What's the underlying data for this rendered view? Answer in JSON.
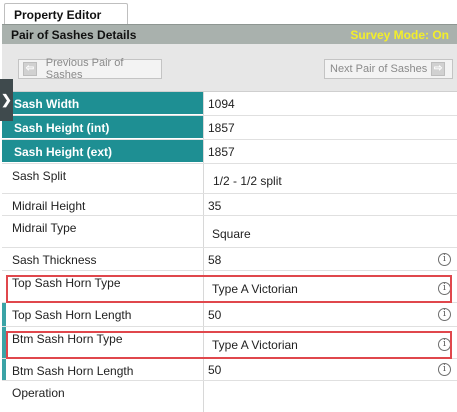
{
  "tab": {
    "label": "Property Editor"
  },
  "header": {
    "title": "Pair of Sashes Details",
    "status": "Survey Mode: On"
  },
  "nav": {
    "prev_label": "Previous Pair of Sashes",
    "next_label": "Next Pair of Sashes"
  },
  "colors": {
    "key_label_bg": "#1e8f93",
    "header_bg": "#a9b1ad",
    "status_text": "#f3ee2a",
    "highlight": "#e0474c"
  },
  "rows": [
    {
      "label": "Sash Width",
      "value": "1094"
    },
    {
      "label": "Sash Height (int)",
      "value": "1857"
    },
    {
      "label": "Sash Height (ext)",
      "value": "1857"
    },
    {
      "label": "Sash Split",
      "value": "1/2 - 1/2 split"
    },
    {
      "label": "Midrail Height",
      "value": "35"
    },
    {
      "label": "Midrail Type",
      "value": "Square"
    },
    {
      "label": "Sash Thickness",
      "value": "58"
    },
    {
      "label": "Top Sash Horn Type",
      "value": "Type A Victorian"
    },
    {
      "label": "Top Sash Horn Length",
      "value": "50"
    },
    {
      "label": "Btm Sash Horn Type",
      "value": "Type A Victorian"
    },
    {
      "label": "Btm Sash Horn Length",
      "value": "50"
    },
    {
      "label": "Operation",
      "value": ""
    }
  ]
}
